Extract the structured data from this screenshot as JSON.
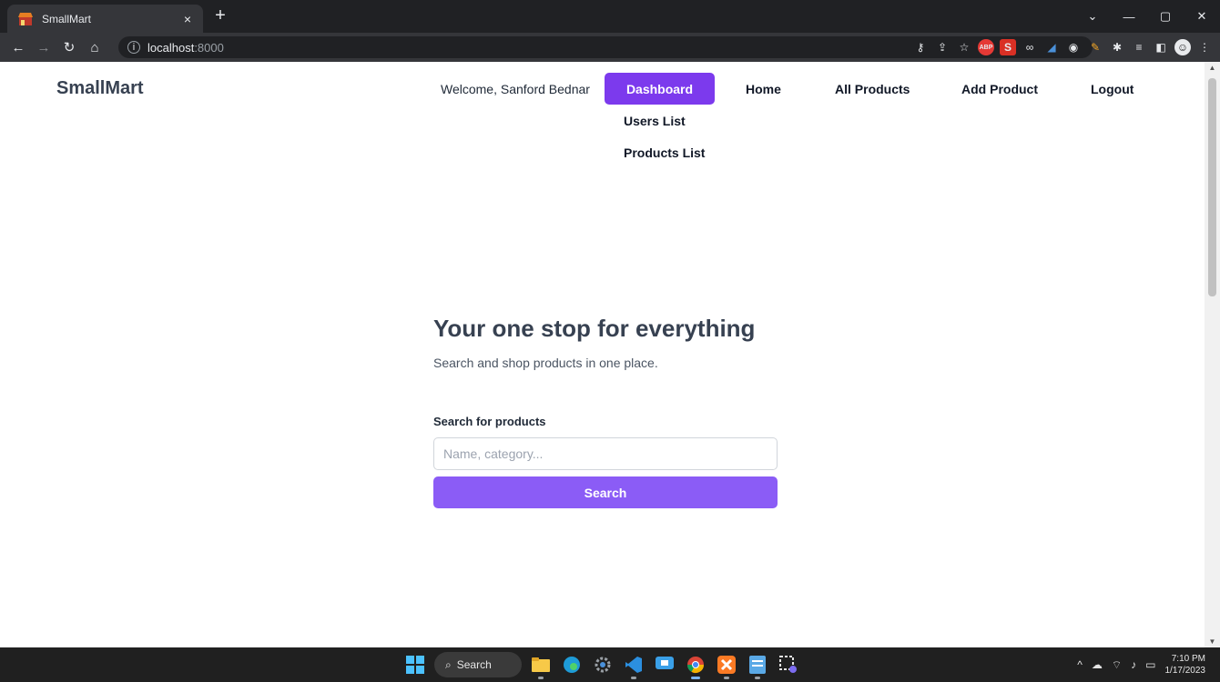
{
  "browser": {
    "tab_title": "SmallMart",
    "tab_close": "×",
    "new_tab": "+",
    "url_host": "localhost",
    "url_port": ":8000",
    "window_controls": {
      "minimize": "—",
      "restore": "▢",
      "close": "✕",
      "tab_list": "⌄"
    }
  },
  "header": {
    "brand": "SmallMart",
    "welcome": "Welcome, Sanford Bednar",
    "nav": {
      "dashboard": "Dashboard",
      "home": "Home",
      "all_products": "All Products",
      "add_product": "Add Product",
      "logout": "Logout"
    },
    "dropdown": {
      "users_list": "Users List",
      "products_list": "Products List"
    }
  },
  "hero": {
    "title": "Your one stop for everything",
    "subtitle": "Search and shop products in one place."
  },
  "search": {
    "label": "Search for products",
    "placeholder": "Name, category...",
    "button": "Search"
  },
  "taskbar": {
    "search_label": "Search",
    "time": "7:10 PM",
    "date": "1/17/2023"
  },
  "colors": {
    "accent": "#7c3aed",
    "button": "#8b5cf6",
    "brand_text": "#374151"
  }
}
